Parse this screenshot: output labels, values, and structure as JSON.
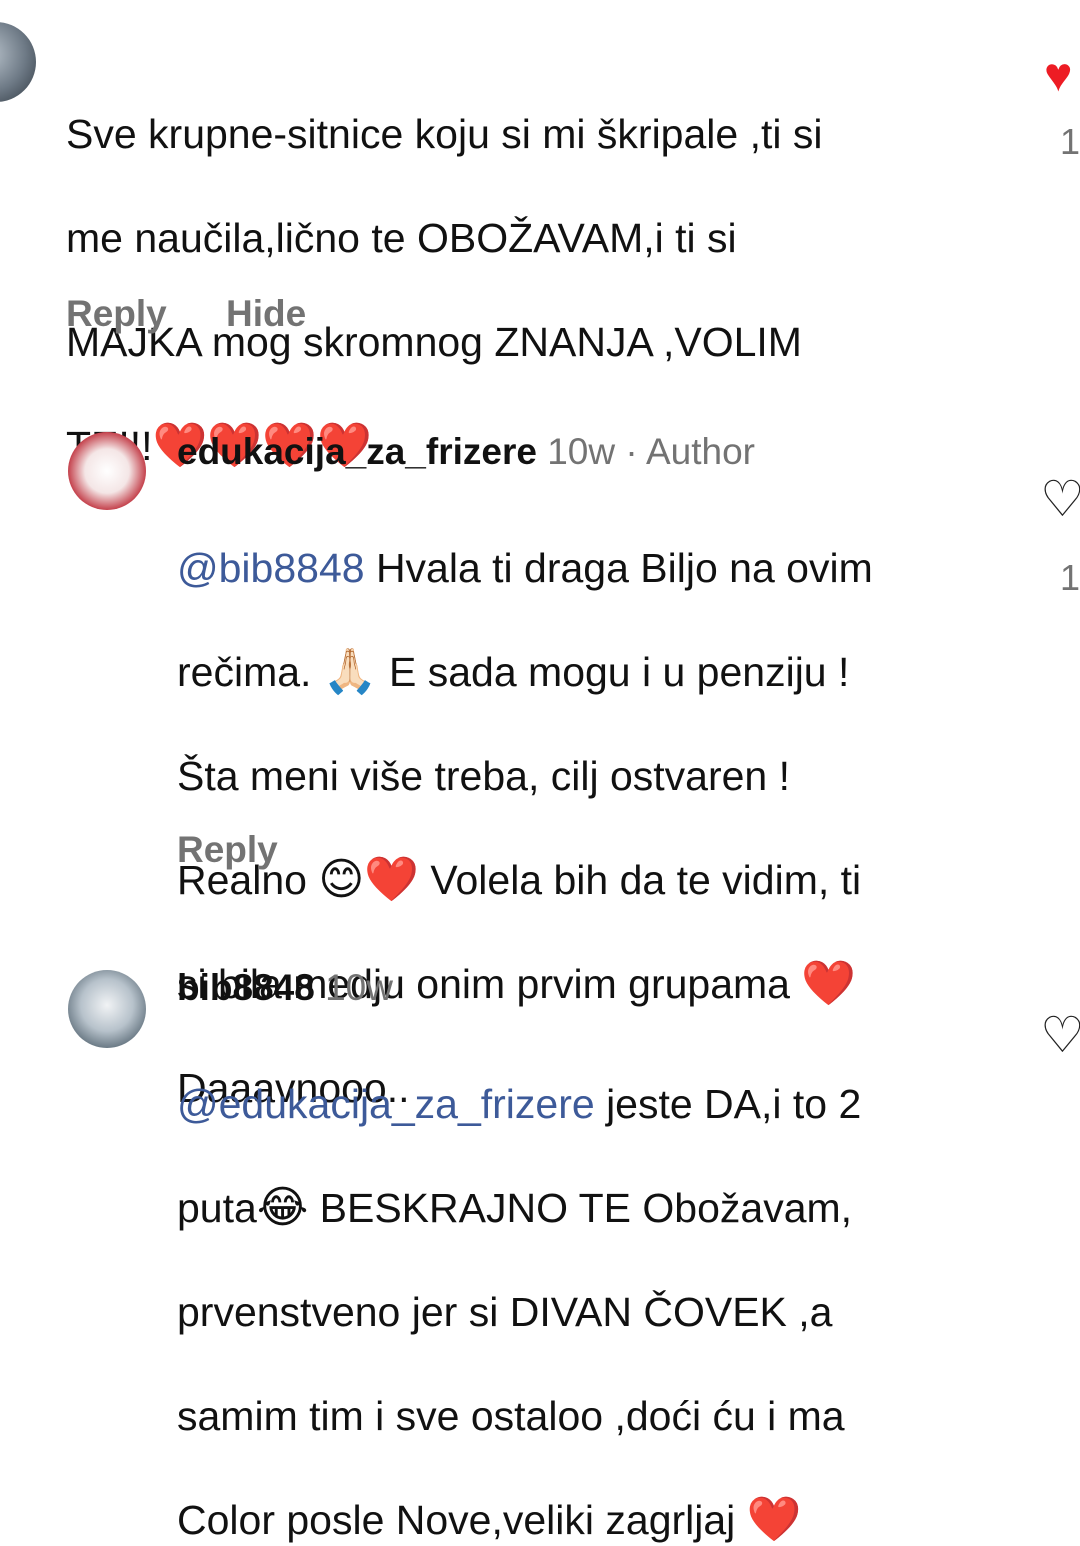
{
  "comments": [
    {
      "text_line1": "Sve krupne-sitnice koju si mi škripale ,ti si",
      "text_line2": "me naučila,lično te OBOŽAVAM,i ti si",
      "text_line3": "MAJKA mog skromnog ZNANJA ,VOLIM",
      "text_line4": "TE!!!",
      "emoji_heart": "❤️",
      "reply_label": "Reply",
      "hide_label": "Hide",
      "like_count": "1"
    },
    {
      "username": "edukacija_za_frizere",
      "time": "10w",
      "separator": " · ",
      "role": "Author",
      "mention": "@bib8848",
      "text_line1": " Hvala ti draga Biljo na ovim",
      "text_line2a": "rečima. ",
      "emoji_pray": "🙏🏻",
      "text_line2b": " E sada mogu i u penziju !",
      "text_line3": "Šta meni više treba, cilj ostvaren !",
      "text_line4a": "Realno ",
      "emoji_smile": "😊",
      "emoji_heart": "❤️",
      "text_line4b": " Volela bih da te vidim, ti",
      "text_line5": "si bila medju onim prvim grupama ",
      "text_line6": "Daaavnooo..",
      "reply_label": "Reply",
      "like_count": "1"
    },
    {
      "username": "bib8848",
      "time": "10w",
      "mention": "@edukacija_za_frizere",
      "text_line1": " jeste DA,i to 2",
      "text_line2a": "puta",
      "emoji_laugh": "😂",
      "text_line2b": " BESKRAJNO TE  Obožavam,",
      "text_line3": "prvenstveno jer si DIVAN ČOVEK ,a",
      "text_line4": "samim tim i sve ostaloo ,doći ću i ma",
      "text_line5": "Color posle Nove,veliki zagrljaj ",
      "emoji_heart": "❤️"
    }
  ],
  "icons": {
    "liked": "heart-filled-icon",
    "unliked": "heart-outline-icon"
  },
  "colors": {
    "mention": "#3d5a99",
    "secondary_text": "#737373",
    "like_red": "#ed1c24"
  }
}
